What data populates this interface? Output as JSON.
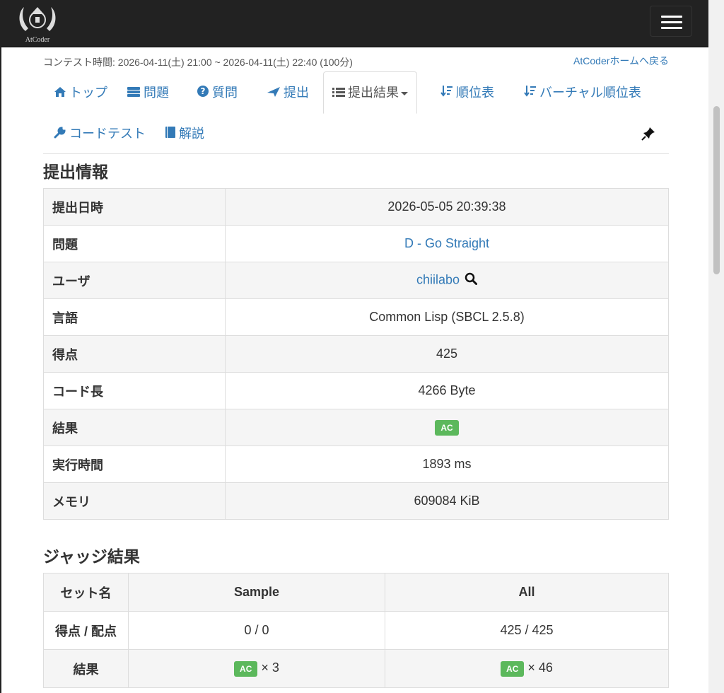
{
  "header": {
    "logo_text": "AtCoder",
    "menu_icon": "hamburger-icon"
  },
  "contest": {
    "time_text": "コンテスト時間: 2026-04-11(土) 21:00 ~ 2026-04-11(土) 22:40 (100分)",
    "home_link": "AtCoderホームへ戻る"
  },
  "nav": {
    "tabs": [
      {
        "label": "トップ",
        "icon": "home-icon"
      },
      {
        "label": "問題",
        "icon": "tasks-icon"
      },
      {
        "label": "質問",
        "icon": "question-icon"
      },
      {
        "label": "提出",
        "icon": "send-icon"
      },
      {
        "label": "提出結果",
        "icon": "list-icon"
      },
      {
        "label": "順位表",
        "icon": "sort-icon"
      },
      {
        "label": "バーチャル順位表",
        "icon": "sort-icon"
      },
      {
        "label": "コードテスト",
        "icon": "wrench-icon"
      },
      {
        "label": "解説",
        "icon": "book-icon"
      }
    ],
    "pin_icon": "pushpin-icon"
  },
  "submission": {
    "heading": "提出情報",
    "rows": [
      {
        "key": "提出日時",
        "value": "2026-05-05 20:39:38"
      },
      {
        "key": "問題",
        "value": "D - Go Straight"
      },
      {
        "key": "ユーザ",
        "value": "chiilabo"
      },
      {
        "key": "言語",
        "value": "Common Lisp (SBCL 2.5.8)"
      },
      {
        "key": "得点",
        "value": "425"
      },
      {
        "key": "コード長",
        "value": "4266 Byte"
      },
      {
        "key": "結果",
        "value": "AC"
      },
      {
        "key": "実行時間",
        "value": "1893 ms"
      },
      {
        "key": "メモリ",
        "value": "609084 KiB"
      }
    ]
  },
  "judge": {
    "heading": "ジャッジ結果",
    "col_header": "セット名",
    "sets": [
      "Sample",
      "All"
    ],
    "score_label": "得点 / 配点",
    "scores": [
      "0 / 0",
      "425 / 425"
    ],
    "result_label": "結果",
    "results": [
      {
        "badge": "AC",
        "count": "× 3"
      },
      {
        "badge": "AC",
        "count": "× 46"
      }
    ]
  },
  "colors": {
    "accent": "#337ab7",
    "ac_badge": "#5cb85c",
    "navbar": "#222222"
  }
}
